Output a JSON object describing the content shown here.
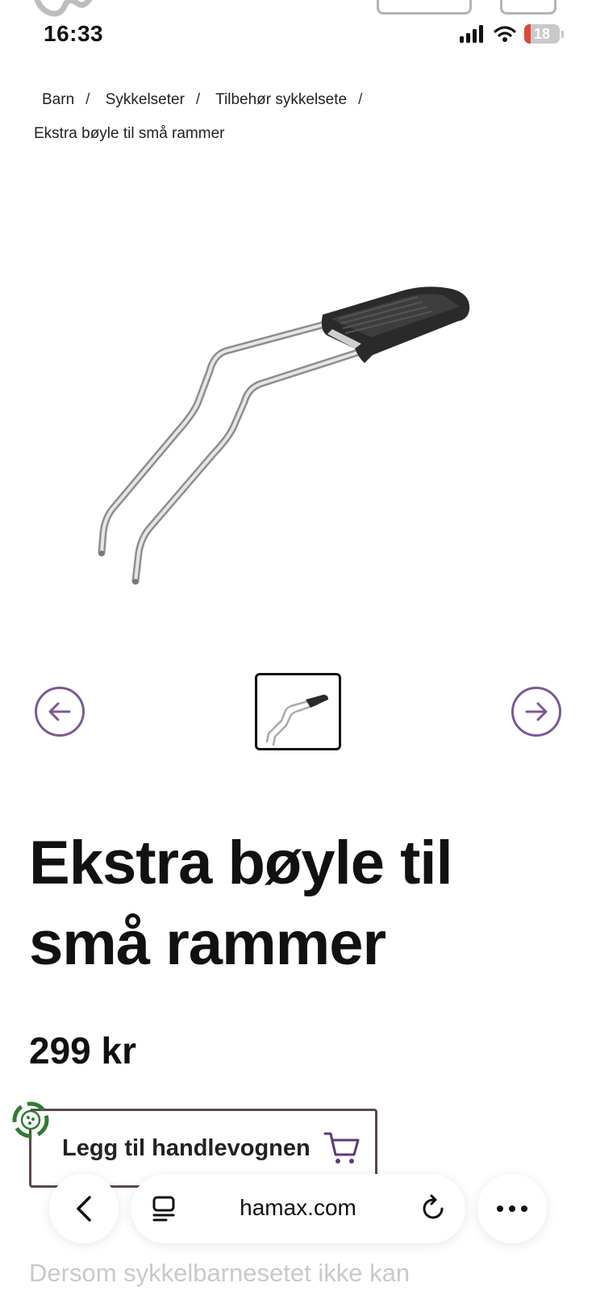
{
  "status_bar": {
    "time": "16:33",
    "battery_level": "18",
    "icons": [
      "cellular-signal-icon",
      "wifi-icon",
      "battery-icon"
    ]
  },
  "breadcrumb": {
    "items": [
      "Barn",
      "Sykkelseter",
      "Tilbehør sykkelsete"
    ],
    "separator": "/",
    "current": "Ekstra bøyle til små rammer"
  },
  "gallery": {
    "prev_icon": "arrow-left-icon",
    "next_icon": "arrow-right-icon"
  },
  "product": {
    "title": "Ekstra bøyle til små rammer",
    "price": "299 kr",
    "add_to_cart_label": "Legg til handlevognen",
    "description_start": "Dersom sykkelbarnesetet ikke kan"
  },
  "browser": {
    "url": "hamax.com"
  },
  "colors": {
    "accent_purple": "#7a5a96",
    "button_border": "#5a4a48",
    "eco_green": "#2e7d32",
    "battery_red": "#e2453c"
  }
}
